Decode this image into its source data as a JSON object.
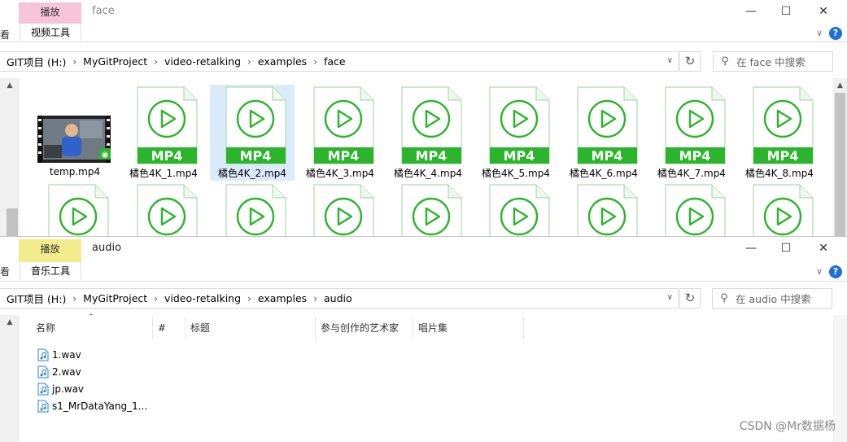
{
  "windows": [
    {
      "context_tab": "播放",
      "title": "face",
      "tool_tab": "视频工具",
      "left_tab_fragment": "看",
      "address": [
        "GIT项目 (H:)",
        "MyGitProject",
        "video-retalking",
        "examples",
        "face"
      ],
      "search_placeholder": "在 face 中搜索",
      "files": [
        {
          "name": "temp.mp4",
          "kind": "thumbnail"
        },
        {
          "name": "橘色4K_1.mp4",
          "kind": "mp4"
        },
        {
          "name": "橘色4K_2.mp4",
          "kind": "mp4",
          "selected": true
        },
        {
          "name": "橘色4K_3.mp4",
          "kind": "mp4"
        },
        {
          "name": "橘色4K_4.mp4",
          "kind": "mp4"
        },
        {
          "name": "橘色4K_5.mp4",
          "kind": "mp4"
        },
        {
          "name": "橘色4K_6.mp4",
          "kind": "mp4"
        },
        {
          "name": "橘色4K_7.mp4",
          "kind": "mp4"
        },
        {
          "name": "橘色4K_8.mp4",
          "kind": "mp4"
        }
      ],
      "mp4_badge": "MP4"
    },
    {
      "context_tab": "播放",
      "title": "audio",
      "tool_tab": "音乐工具",
      "left_tab_fragment": "看",
      "address": [
        "GIT项目 (H:)",
        "MyGitProject",
        "video-retalking",
        "examples",
        "audio"
      ],
      "search_placeholder": "在 audio 中搜索",
      "columns": [
        "名称",
        "#",
        "标题",
        "参与创作的艺术家",
        "唱片集"
      ],
      "files": [
        "1.wav",
        "2.wav",
        "jp.wav",
        "s1_MrDataYang_1..."
      ]
    }
  ],
  "window_controls": {
    "minimize": "—",
    "maximize": "☐",
    "close": "✕"
  },
  "watermark": "CSDN @Mr数据杨",
  "colors": {
    "mp4_green": "#2cb52c",
    "selection": "#dcebfc",
    "help_blue": "#1e6fd9",
    "audio_icon": "#2b7cd3"
  }
}
